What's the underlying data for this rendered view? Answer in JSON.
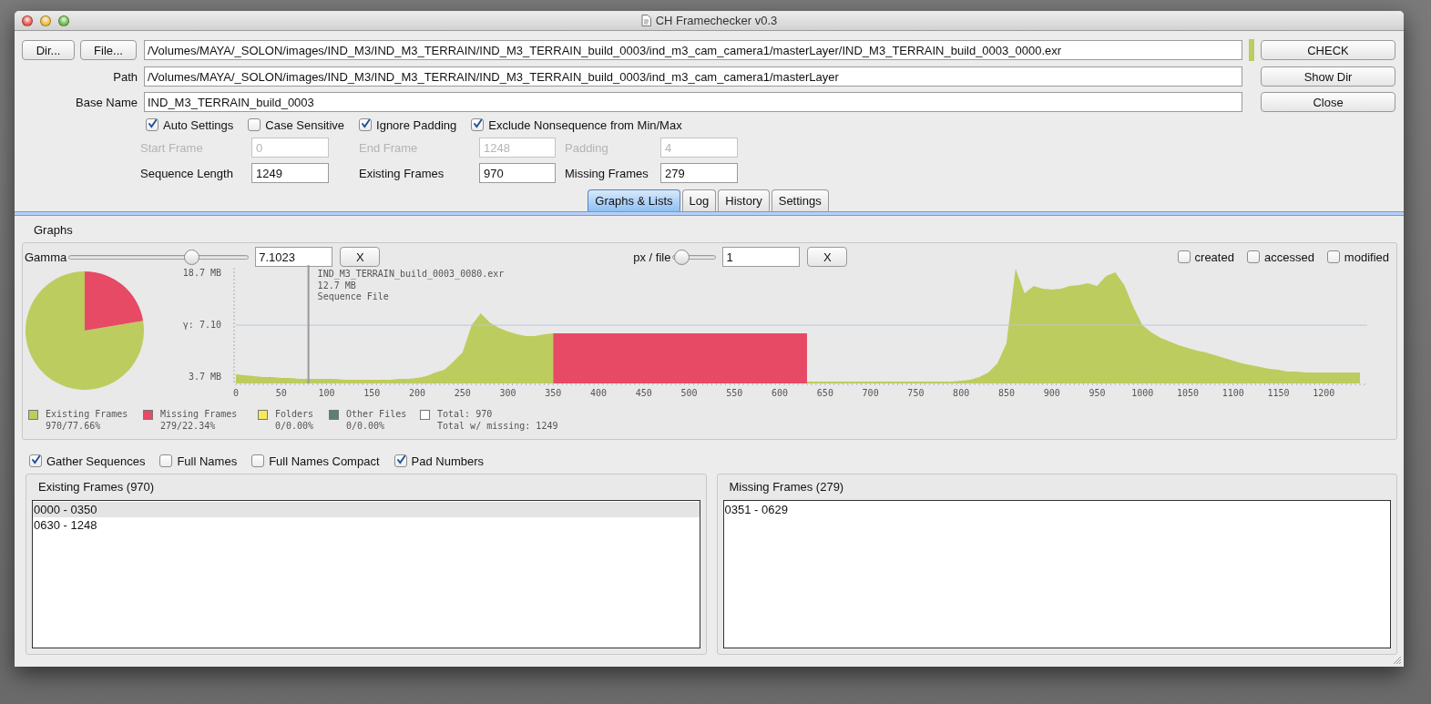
{
  "window": {
    "title": "CH Framechecker v0.3"
  },
  "source": {
    "buttons": [
      "Dir...",
      "File..."
    ],
    "file_path": "/Volumes/MAYA/_SOLON/images/IND_M3/IND_M3_TERRAIN/IND_M3_TERRAIN_build_0003/ind_m3_cam_camera1/masterLayer/IND_M3_TERRAIN_build_0003_0000.exr",
    "check_passed": true
  },
  "fields": [
    {
      "label": "Path",
      "value": "/Volumes/MAYA/_SOLON/images/IND_M3/IND_M3_TERRAIN/IND_M3_TERRAIN_build_0003/ind_m3_cam_camera1/masterLayer"
    },
    {
      "label": "Base Name",
      "value": "IND_M3_TERRAIN_build_0003"
    }
  ],
  "actions": [
    "CHECK",
    "Show Dir",
    "Close"
  ],
  "options": [
    {
      "label": "Auto Settings",
      "checked": true
    },
    {
      "label": "Case Sensitive",
      "checked": false
    },
    {
      "label": "Ignore Padding",
      "checked": true
    },
    {
      "label": "Exclude Nonsequence from Min/Max",
      "checked": true
    }
  ],
  "frame_settings": [
    {
      "label": "Start Frame",
      "value": "0",
      "disabled": true
    },
    {
      "label": "End Frame",
      "value": "1248",
      "disabled": true
    },
    {
      "label": "Padding",
      "value": "4",
      "disabled": true
    },
    {
      "label": "Sequence Length",
      "value": "1249",
      "disabled": false
    },
    {
      "label": "Existing Frames",
      "value": "970",
      "disabled": false
    },
    {
      "label": "Missing Frames",
      "value": "279",
      "disabled": false
    }
  ],
  "tabs": [
    {
      "label": "Graphs & Lists",
      "selected": true
    },
    {
      "label": "Log",
      "selected": false
    },
    {
      "label": "History",
      "selected": false
    },
    {
      "label": "Settings",
      "selected": false
    }
  ],
  "graphs": {
    "title": "Graphs",
    "sliders": [
      {
        "label": "Gamma",
        "level": 0.68,
        "value": "7.1023",
        "reset": "X"
      },
      {
        "label": "px / file",
        "level": 0.2,
        "value": "1",
        "reset": "X"
      }
    ],
    "time_filters": [
      {
        "label": "created",
        "checked": false
      },
      {
        "label": "accessed",
        "checked": false
      },
      {
        "label": "modified",
        "checked": false
      }
    ],
    "pie": {
      "chart_data": {
        "type": "pie",
        "values": [
          77.66,
          22.34
        ]
      }
    },
    "size_graph": {
      "y_labels": [
        "18.7 MB",
        "γ: 7.10",
        "3.7 MB"
      ],
      "x_labels": [
        "0",
        "50",
        "100",
        "150",
        "200",
        "250",
        "300",
        "350",
        "400",
        "450",
        "500",
        "550",
        "600",
        "650",
        "700",
        "750",
        "800",
        "850",
        "900",
        "950",
        "1000",
        "1050",
        "1100",
        "1150",
        "1200"
      ],
      "tooltip": [
        "IND_M3_TERRAIN_build_0003_0080.exr",
        "12.7 MB",
        "Sequence File"
      ]
    },
    "legend": [
      {
        "label": "Existing Frames",
        "detail": "970/77.66%",
        "color": "#bdcc5e"
      },
      {
        "label": "Missing Frames",
        "detail": "279/22.34%",
        "color": "#e64a65"
      },
      {
        "label": "Folders",
        "detail": "0/0.00%",
        "color": "#f7e95c"
      },
      {
        "label": "Other Files",
        "detail": "0/0.00%",
        "color": "#5e7d76"
      },
      {
        "label": "Total: 970",
        "detail": "Total w/ missing: 1249",
        "color": "#ffffff"
      }
    ]
  },
  "list_options": [
    {
      "label": "Gather Sequences",
      "checked": true
    },
    {
      "label": "Full Names",
      "checked": false
    },
    {
      "label": "Full Names Compact",
      "checked": false
    },
    {
      "label": "Pad Numbers",
      "checked": true
    }
  ],
  "lists": [
    {
      "title": "Existing Frames (970)",
      "items": [
        {
          "text": "0000 - 0350",
          "selected": true
        },
        {
          "text": "0630 - 1248",
          "selected": false
        }
      ]
    },
    {
      "title": "Missing Frames (279)",
      "items": [
        {
          "text": "0351 - 0629",
          "selected": false
        }
      ]
    }
  ]
}
